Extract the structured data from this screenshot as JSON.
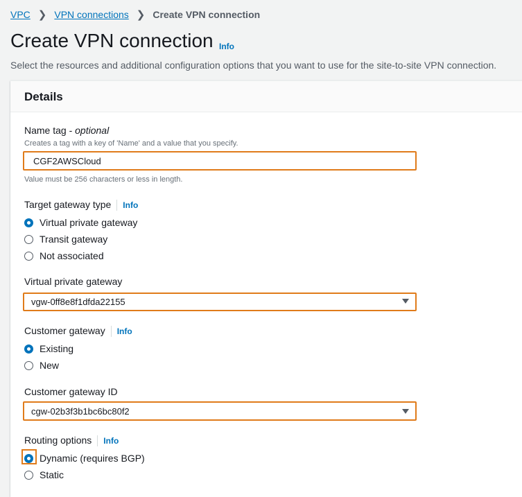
{
  "breadcrumb": {
    "items": [
      "VPC",
      "VPN connections"
    ],
    "current": "Create VPN connection"
  },
  "header": {
    "title": "Create VPN connection",
    "info": "Info",
    "description": "Select the resources and additional configuration options that you want to use for the site-to-site VPN connection."
  },
  "panel": {
    "title": "Details"
  },
  "name_tag": {
    "label": "Name tag -",
    "optional": "optional",
    "hint": "Creates a tag with a key of 'Name' and a value that you specify.",
    "value": "CGF2AWSCloud",
    "constraint": "Value must be 256 characters or less in length."
  },
  "target_gateway": {
    "label": "Target gateway type",
    "info": "Info",
    "options": [
      "Virtual private gateway",
      "Transit gateway",
      "Not associated"
    ],
    "selected": "Virtual private gateway"
  },
  "vpg": {
    "label": "Virtual private gateway",
    "value": "vgw-0ff8e8f1dfda22155"
  },
  "customer_gateway": {
    "label": "Customer gateway",
    "info": "Info",
    "options": [
      "Existing",
      "New"
    ],
    "selected": "Existing"
  },
  "cgw_id": {
    "label": "Customer gateway ID",
    "value": "cgw-02b3f3b1bc6bc80f2"
  },
  "routing": {
    "label": "Routing options",
    "info": "Info",
    "options": [
      "Dynamic (requires BGP)",
      "Static"
    ],
    "selected": "Dynamic (requires BGP)"
  },
  "colors": {
    "link": "#0073bb",
    "highlight": "#e07b1a",
    "text": "#16191f"
  }
}
